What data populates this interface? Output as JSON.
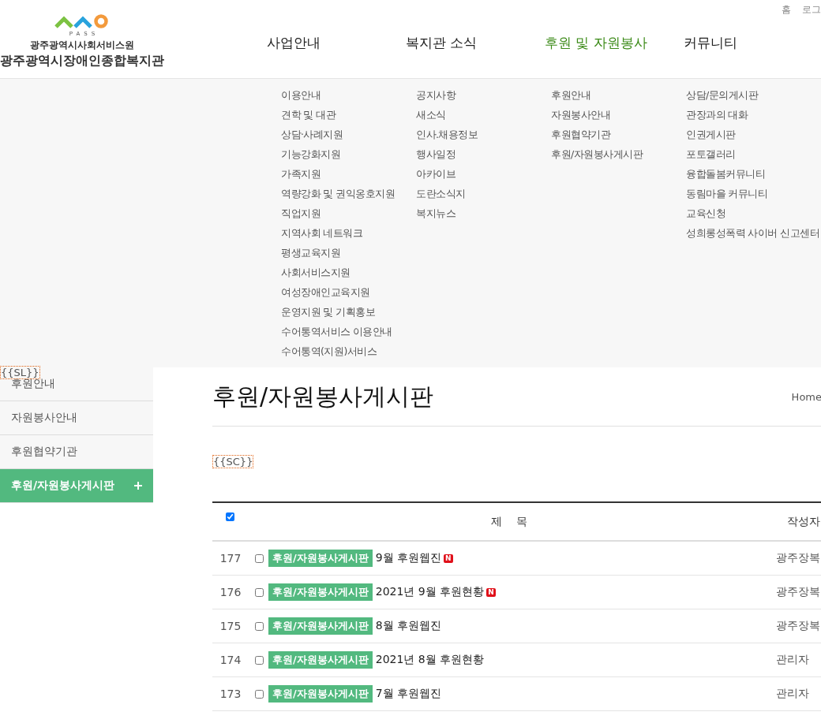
{
  "top_links": [
    "홈",
    "로그"
  ],
  "logo": {
    "mark_text": "PASS",
    "org": "광주광역시사회서비스원",
    "name": "광주광역시장애인종합복지관"
  },
  "nav": [
    {
      "label": "사업안내",
      "selected": false,
      "submenu": [
        "이용안내",
        "견학 및 대관",
        "상담·사례지원",
        "기능강화지원",
        "가족지원",
        "역량강화 및 권익옹호지원",
        "직업지원",
        "지역사회 네트워크",
        "평생교육지원",
        "사회서비스지원",
        "여성장애인교육지원",
        "운영지원 및 기획홍보",
        "수어통역서비스 이용안내",
        "수어통역(지원)서비스"
      ]
    },
    {
      "label": "복지관 소식",
      "selected": false,
      "submenu": [
        "공지사항",
        "새소식",
        "인사.채용정보",
        "행사일정",
        "아카이브",
        "도란소식지",
        "복지뉴스"
      ]
    },
    {
      "label": "후원 및 자원봉사",
      "selected": true,
      "submenu": [
        "후원안내",
        "자원봉사안내",
        "후원협약기관",
        "후원/자원봉사게시판"
      ]
    },
    {
      "label": "커뮤니티",
      "selected": false,
      "submenu": [
        "상담/문의게시판",
        "관장과의 대화",
        "인권게시판",
        "포토갤러리",
        "융합돌봄커뮤니티",
        "동림마을 커뮤니티",
        "교육신청",
        "성희롱성폭력 사이버 신고센터"
      ]
    }
  ],
  "sidebar": {
    "placeholder_tag": "{{SL}}",
    "items": [
      {
        "label": "후원안내",
        "selected": false
      },
      {
        "label": "자원봉사안내",
        "selected": false
      },
      {
        "label": "후원협약기관",
        "selected": false
      },
      {
        "label": "후원/자원봉사게시판",
        "selected": true
      }
    ]
  },
  "page": {
    "title": "후원/자원봉사게시판",
    "breadcrumb": "Home",
    "placeholder_tag": "{{SC}}"
  },
  "table": {
    "select_all_checked": true,
    "columns": [
      "제    목",
      "작성자"
    ],
    "rows": [
      {
        "number": "177",
        "checked": false,
        "category": "후원/자원봉사게시판",
        "title": "9월 후원웹진",
        "badge": "N",
        "author": "광주장복"
      },
      {
        "number": "176",
        "checked": false,
        "category": "후원/자원봉사게시판",
        "title": "2021년 9월 후원현황",
        "badge": "N",
        "author": "광주장복"
      },
      {
        "number": "175",
        "checked": false,
        "category": "후원/자원봉사게시판",
        "title": "8월 후원웹진",
        "author": "광주장복"
      },
      {
        "number": "174",
        "checked": false,
        "category": "후원/자원봉사게시판",
        "title": "2021년 8월 후원현황",
        "author": "관리자"
      },
      {
        "number": "173",
        "checked": false,
        "category": "후원/자원봉사게시판",
        "title": "7월 후원웹진",
        "author": "관리자"
      }
    ]
  }
}
